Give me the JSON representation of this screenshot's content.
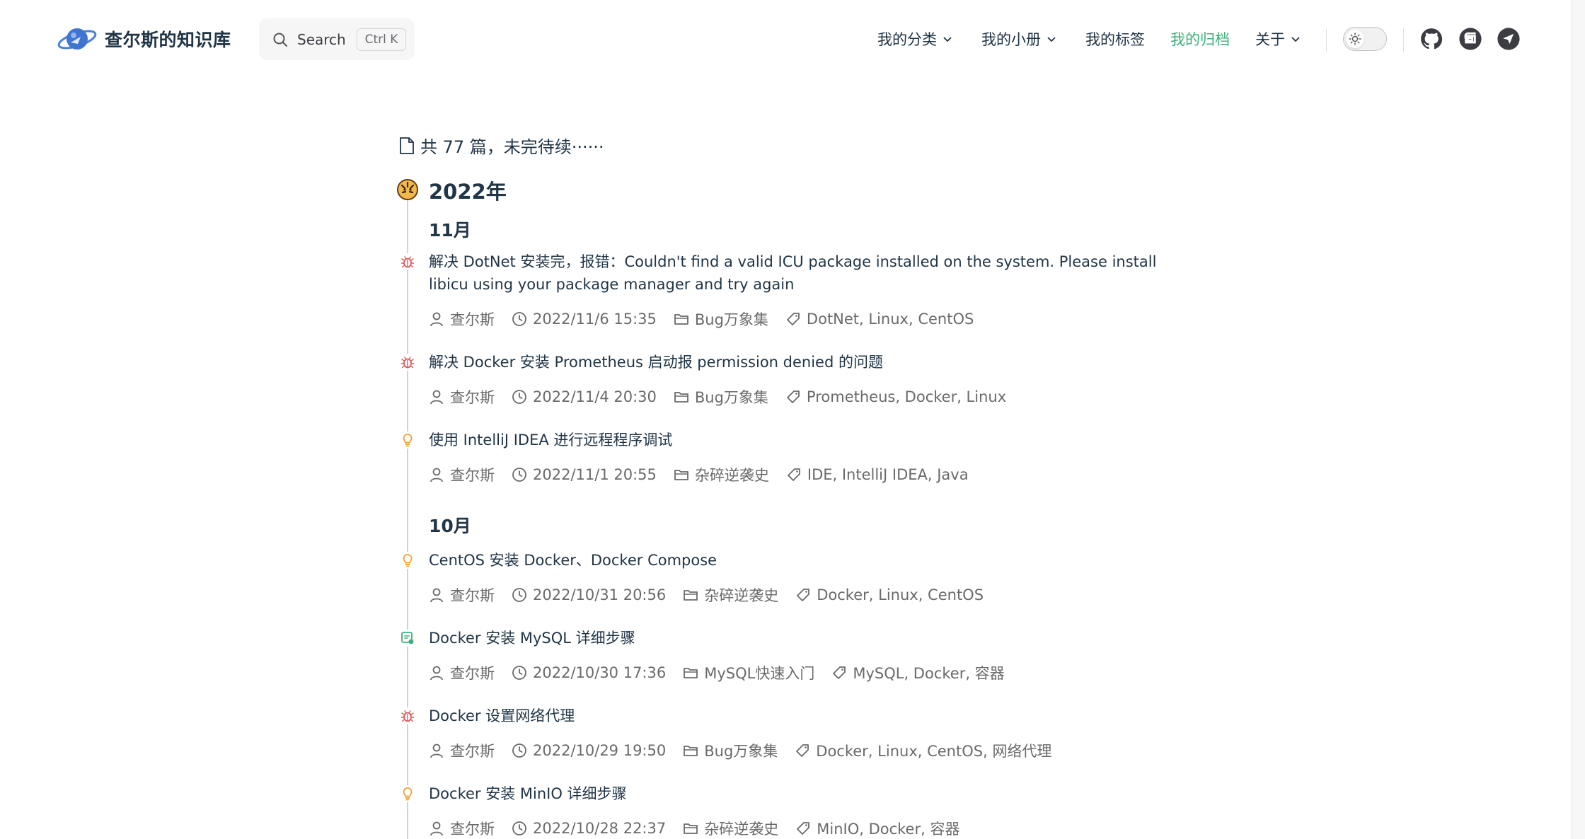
{
  "site": {
    "title": "查尔斯的知识库"
  },
  "search": {
    "label": "Search",
    "shortcut": "Ctrl K"
  },
  "nav": {
    "items": [
      {
        "label": "我的分类",
        "has_dropdown": true
      },
      {
        "label": "我的小册",
        "has_dropdown": true
      },
      {
        "label": "我的标签",
        "has_dropdown": false
      },
      {
        "label": "我的归档",
        "has_dropdown": false,
        "active": true
      },
      {
        "label": "关于",
        "has_dropdown": true
      }
    ]
  },
  "social": [
    "github-icon",
    "gitee-icon",
    "telegram-icon"
  ],
  "colors": {
    "accent": "#3eaf7c",
    "text": "#213547",
    "muted": "#6a6a6a",
    "timeline": "#bcd6f5"
  },
  "archive": {
    "summary": "共 77 篇，未完待续······",
    "year": "2022年",
    "months": [
      {
        "label": "11月",
        "posts": [
          {
            "title": "解决 DotNet 安装完，报错：Couldn't find a valid ICU package installed on the system. Please install libicu using your package manager and try again",
            "author": "查尔斯",
            "date": "2022/11/6 15:35",
            "category": "Bug万象集",
            "tags": "DotNet, Linux, CentOS",
            "icon": "bug-icon"
          },
          {
            "title": "解决 Docker 安装 Prometheus 启动报 permission denied 的问题",
            "author": "查尔斯",
            "date": "2022/11/4 20:30",
            "category": "Bug万象集",
            "tags": "Prometheus, Docker, Linux",
            "icon": "bug-icon"
          },
          {
            "title": "使用 IntelliJ IDEA 进行远程程序调试",
            "author": "查尔斯",
            "date": "2022/11/1 20:55",
            "category": "杂碎逆袭史",
            "tags": "IDE, IntelliJ IDEA, Java",
            "icon": "lightbulb-icon"
          }
        ]
      },
      {
        "label": "10月",
        "posts": [
          {
            "title": "CentOS 安装 Docker、Docker Compose",
            "author": "查尔斯",
            "date": "2022/10/31 20:56",
            "category": "杂碎逆袭史",
            "tags": "Docker, Linux, CentOS",
            "icon": "lightbulb-icon"
          },
          {
            "title": "Docker 安装 MySQL 详细步骤",
            "author": "查尔斯",
            "date": "2022/10/30 17:36",
            "category": "MySQL快速入门",
            "tags": "MySQL, Docker, 容器",
            "icon": "database-icon"
          },
          {
            "title": "Docker 设置网络代理",
            "author": "查尔斯",
            "date": "2022/10/29 19:50",
            "category": "Bug万象集",
            "tags": "Docker, Linux, CentOS, 网络代理",
            "icon": "bug-icon"
          },
          {
            "title": "Docker 安装 MinIO 详细步骤",
            "author": "查尔斯",
            "date": "2022/10/28 22:37",
            "category": "杂碎逆袭史",
            "tags": "MinIO, Docker, 容器",
            "icon": "lightbulb-icon"
          }
        ]
      }
    ]
  }
}
